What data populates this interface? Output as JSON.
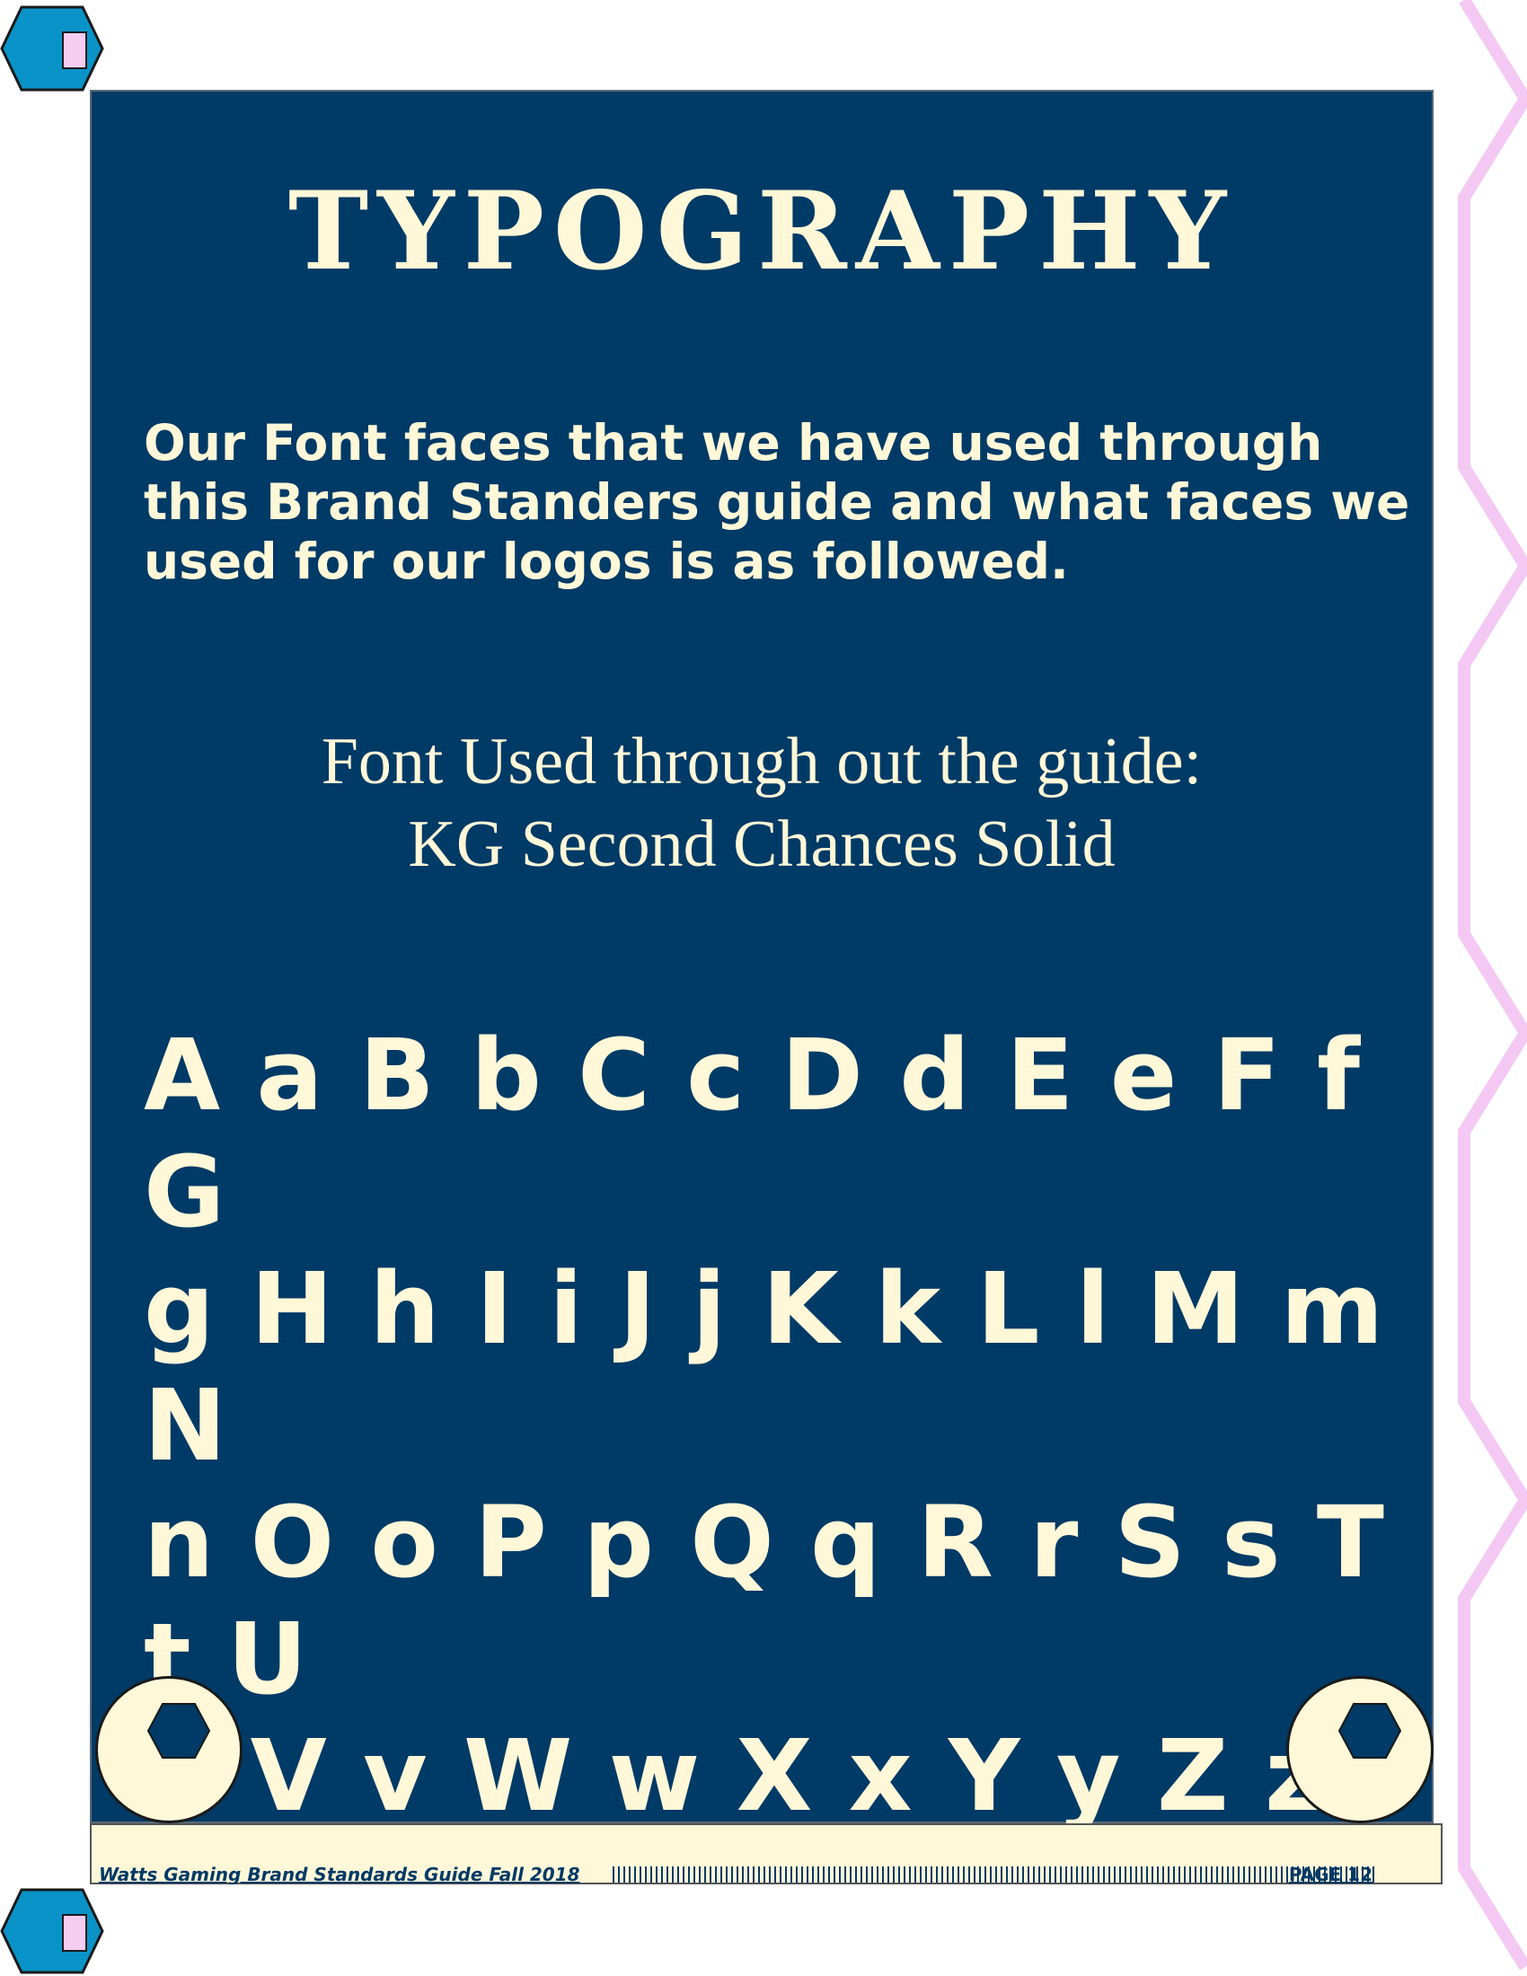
{
  "page": {
    "title": "TYPOGRAPHY",
    "intro": "Our Font faces that we have used through this Brand Standers guide and what faces we used for our logos is as followed.",
    "font_label": "Font Used through out the guide:",
    "font_name": "KG Second Chances Solid",
    "alphabet_lines": [
      "A a B b C c D d E e F f G",
      "g H h I i J j K k L l M m N",
      "n O o P p Q q R r S s T t U",
      "u V v W w X x Y y Z z"
    ]
  },
  "footer": {
    "guide_title": "Watts Gaming Brand Standards Guide Fall 2018",
    "page_label": "PAGE 12"
  },
  "colors": {
    "panel": "#003a66",
    "cream": "#fff8d8",
    "corner_hex": "#0a93c8",
    "corner_inner": "#f5cdf0",
    "zigzag": "#f3c9f4"
  },
  "icons": {
    "corner_marks": "hexagon-icon",
    "circle_marks": "hexagon-icon"
  }
}
